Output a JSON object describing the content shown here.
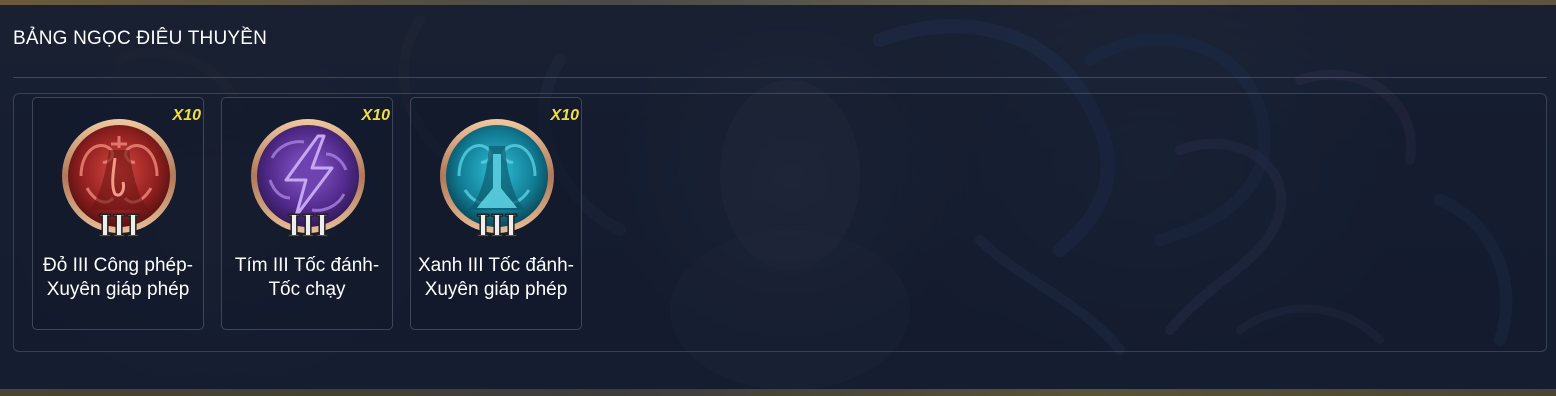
{
  "panel": {
    "title": "BẢNG NGỌC ĐIÊU THUYỀN"
  },
  "gems": [
    {
      "name": "Đỏ III Công phép-Xuyên giáp phép",
      "count": "X10",
      "tier": "III",
      "color": "#b8302e",
      "icon": "red-gem-icon"
    },
    {
      "name": "Tím III Tốc đánh-Tốc chạy",
      "count": "X10",
      "tier": "III",
      "color": "#6a3aa8",
      "icon": "purple-lightning-gem-icon"
    },
    {
      "name": "Xanh III Tốc đánh-Xuyên giáp phép",
      "count": "X10",
      "tier": "III",
      "color": "#1a8ea8",
      "icon": "blue-gem-icon"
    }
  ],
  "colors": {
    "count_badge": "#f2de3a",
    "overlay": "#141c30"
  }
}
